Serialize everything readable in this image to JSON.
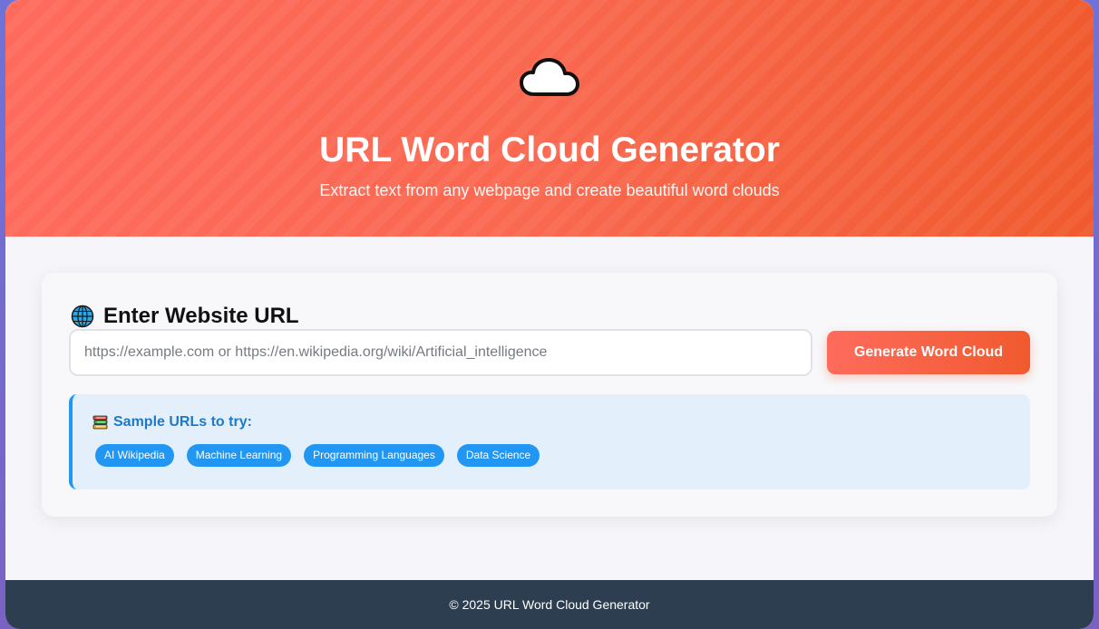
{
  "hero": {
    "icon": "cloud-icon",
    "title": "URL Word Cloud Generator",
    "subtitle": "Extract text from any webpage and create beautiful word clouds"
  },
  "form": {
    "heading_icon": "globe-icon",
    "heading": "Enter Website URL",
    "url_input": {
      "value": "",
      "placeholder": "https://example.com or https://en.wikipedia.org/wiki/Artificial_intelligence"
    },
    "generate_label": "Generate Word Cloud"
  },
  "samples": {
    "icon": "books-icon",
    "heading": "Sample URLs to try:",
    "chips": [
      {
        "label": "AI Wikipedia"
      },
      {
        "label": "Machine Learning"
      },
      {
        "label": "Programming Languages"
      },
      {
        "label": "Data Science"
      }
    ]
  },
  "footer": {
    "text": "© 2025 URL Word Cloud Generator"
  },
  "colors": {
    "hero_gradient_start": "#fe6a5c",
    "hero_gradient_end": "#f05a2d",
    "chip_blue": "#2196f3",
    "samples_bg": "#e3f0fc",
    "samples_heading": "#1e78c8",
    "footer_bg": "#2d3e50",
    "page_bg": "#f6f6fa"
  }
}
